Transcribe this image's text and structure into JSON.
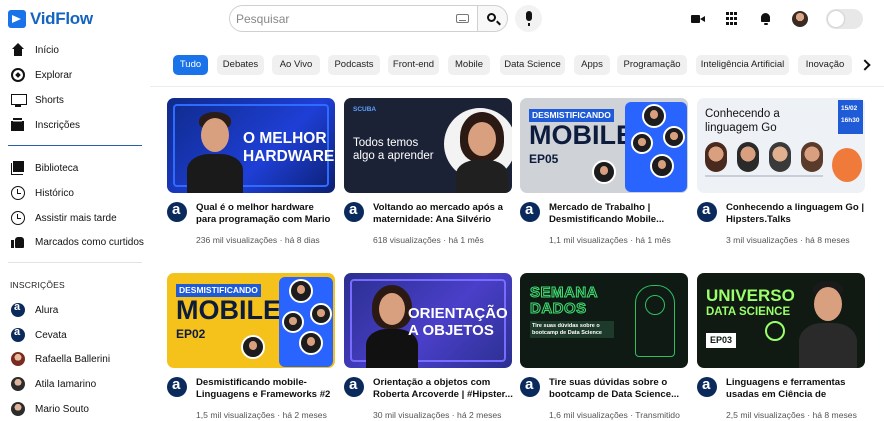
{
  "app": {
    "name": "VidFlow"
  },
  "colors": {
    "accent": "#1a73e8",
    "brand": "#1565c0",
    "channel": "#0b2a5c"
  },
  "search": {
    "placeholder": "Pesquisar"
  },
  "sidebar": {
    "main": [
      {
        "label": "Início",
        "icon": "home-icon"
      },
      {
        "label": "Explorar",
        "icon": "compass-icon"
      },
      {
        "label": "Shorts",
        "icon": "shorts-icon"
      },
      {
        "label": "Inscrições",
        "icon": "subscriptions-icon"
      }
    ],
    "library": [
      {
        "label": "Biblioteca",
        "icon": "library-icon"
      },
      {
        "label": "Histórico",
        "icon": "history-icon"
      },
      {
        "label": "Assistir mais tarde",
        "icon": "watch-later-icon"
      },
      {
        "label": "Marcados como curtidos",
        "icon": "like-icon"
      }
    ],
    "subscriptions_title": "INSCRIÇÕES",
    "subscriptions": [
      {
        "label": "Alura"
      },
      {
        "label": "Cevata"
      },
      {
        "label": "Rafaella Ballerini"
      },
      {
        "label": "Atila Iamarino"
      },
      {
        "label": "Mario Souto"
      }
    ]
  },
  "chips": [
    "Tudo",
    "Debates",
    "Ao Vivo",
    "Podcasts",
    "Front-end",
    "Mobile",
    "Data Science",
    "Apps",
    "Programação",
    "Inteligência Artificial",
    "Inovação"
  ],
  "videos": [
    {
      "title": "Qual é o melhor hardware para programação com Mario Souto",
      "meta": "236 mil visualizações · há 8 dias",
      "thumb": {
        "line1": "O MELHOR",
        "line2": "HARDWARE"
      }
    },
    {
      "title": "Voltando ao mercado após a maternidade: Ana Silvério",
      "meta": "618 visualizações · há 1 mês",
      "thumb": {
        "brand": "SCUBA",
        "line1": "Todos temos",
        "line2": "algo a aprender"
      }
    },
    {
      "title": "Mercado de Trabalho | Desmistificando Mobile...",
      "meta": "1,1 mil visualizações · há 1 mês",
      "thumb": {
        "banner": "DESMISTIFICANDO",
        "big": "MOBILE",
        "ep": "EP05"
      }
    },
    {
      "title": "Conhecendo a linguagem Go | Hipsters.Talks",
      "meta": "3 mil visualizações · há 8 meses",
      "thumb": {
        "line1": "Conhecendo a",
        "line2": "linguagem Go",
        "date": "15/02",
        "time": "16h30"
      }
    },
    {
      "title": "Desmistificando mobile-Linguagens e Frameworks #2",
      "meta": "1,5 mil visualizações · há 2 meses",
      "thumb": {
        "banner": "DESMISTIFICANDO",
        "big": "MOBILE",
        "ep": "EP02"
      }
    },
    {
      "title": "Orientação a objetos com Roberta Arcoverde | #Hipster...",
      "meta": "30 mil visualizações · há 2 meses",
      "thumb": {
        "line1": "ORIENTAÇÃO",
        "line2": "A OBJETOS"
      }
    },
    {
      "title": "Tire suas dúvidas sobre o bootcamp de Data Science...",
      "meta": "1,6 mil visualizações · Transmitido",
      "thumb": {
        "line1": "SEMANA",
        "line2": "DADOS",
        "sub": "Tire suas dúvidas sobre o bootcamp de Data Science"
      }
    },
    {
      "title": "Linguagens e ferramentas usadas em Ciência de Dados...",
      "meta": "2,5 mil visualizações · há 8 meses",
      "thumb": {
        "line1": "UNIVERSO",
        "line2": "DATA SCIENCE",
        "ep": "EP03"
      }
    }
  ]
}
